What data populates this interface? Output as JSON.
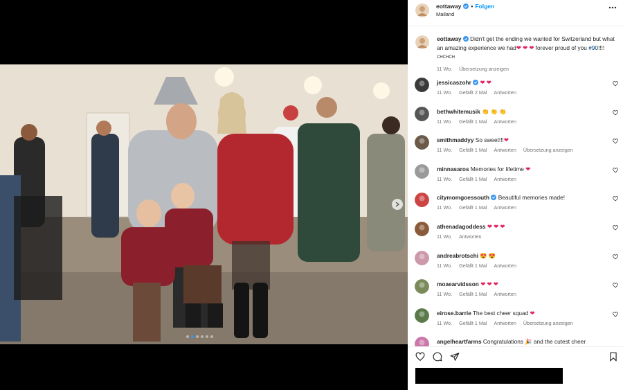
{
  "post": {
    "username": "eottaway",
    "location": "Mailand",
    "follow_label": "Folgen",
    "photo_alt": "Family photo at event",
    "carousel_count": 6,
    "carousel_active_index": 1
  },
  "caption": {
    "username": "eottaway",
    "text_before_hearts": "Didn't get the ending we wanted for Switzerland but what an amazing experience we had",
    "hearts": "❤ ❤ ❤",
    "text_after_hearts": "forever proud of you",
    "hashtag": "#90",
    "suffix": "!!!!",
    "small_tag": "CHCHCH",
    "time": "11 Wo.",
    "translate_label": "Übersetzung anzeigen"
  },
  "comments": [
    {
      "user": "jessicaszohr",
      "verified": true,
      "text": "❤ ❤",
      "time": "11 Wo.",
      "likes": "Gefällt 2 Mal",
      "reply": "Antworten",
      "translate": "",
      "avatar_color": "#3a3a3a"
    },
    {
      "user": "bethwhitemusik",
      "verified": false,
      "text": "👏 👏 👏",
      "time": "11 Wo.",
      "likes": "Gefällt 1 Mal",
      "reply": "Antworten",
      "translate": "",
      "avatar_color": "#555"
    },
    {
      "user": "smithmaddyy",
      "verified": false,
      "text": "So sweet!!!❤",
      "time": "11 Wo.",
      "likes": "Gefällt 1 Mal",
      "reply": "Antworten",
      "translate": "Übersetzung anzeigen",
      "avatar_color": "#6b5a4a"
    },
    {
      "user": "minnasaros",
      "verified": false,
      "text": "Memories for lifetime ❤",
      "time": "11 Wo.",
      "likes": "Gefällt 1 Mal",
      "reply": "Antworten",
      "translate": "",
      "avatar_color": "#9a9a9a"
    },
    {
      "user": "citymomgoessouth",
      "verified": true,
      "text": "Beautiful memories made!",
      "time": "11 Wo.",
      "likes": "Gefällt 1 Mal",
      "reply": "Antworten",
      "translate": "",
      "avatar_color": "#c44"
    },
    {
      "user": "athenadagoddess",
      "verified": false,
      "text": "❤ ❤ ❤",
      "time": "11 Wo.",
      "likes": "",
      "reply": "Antworten",
      "translate": "",
      "avatar_color": "#8a5a3a"
    },
    {
      "user": "andreabrotschi",
      "verified": false,
      "text": "😍 😍",
      "time": "11 Wo.",
      "likes": "Gefällt 1 Mal",
      "reply": "Antworten",
      "translate": "",
      "avatar_color": "#c9a"
    },
    {
      "user": "moaearvidsson",
      "verified": false,
      "text": "❤ ❤ ❤",
      "time": "11 Wo.",
      "likes": "Gefällt 1 Mal",
      "reply": "Antworten",
      "translate": "",
      "avatar_color": "#7a8a5a"
    },
    {
      "user": "eirose.barrie",
      "verified": false,
      "text": "The best cheer squad ❤",
      "time": "11 Wo.",
      "likes": "Gefällt 1 Mal",
      "reply": "Antworten",
      "translate": "Übersetzung anzeigen",
      "avatar_color": "#5a7a4a"
    },
    {
      "user": "angelheartfarms",
      "verified": false,
      "text": "Congratulations 🎉 and the cutest cheer",
      "time": "",
      "likes": "",
      "reply": "",
      "translate": "",
      "avatar_color": "#c7a"
    }
  ],
  "icons": {
    "like": "heart-icon",
    "comment": "comment-icon",
    "share": "share-icon",
    "save": "bookmark-icon",
    "more": "more-icon",
    "next": "chevron-right-icon"
  },
  "colors": {
    "accent": "#0095f6",
    "verified": "#3897f0",
    "heart": "#e0245e",
    "muted": "#737373"
  }
}
